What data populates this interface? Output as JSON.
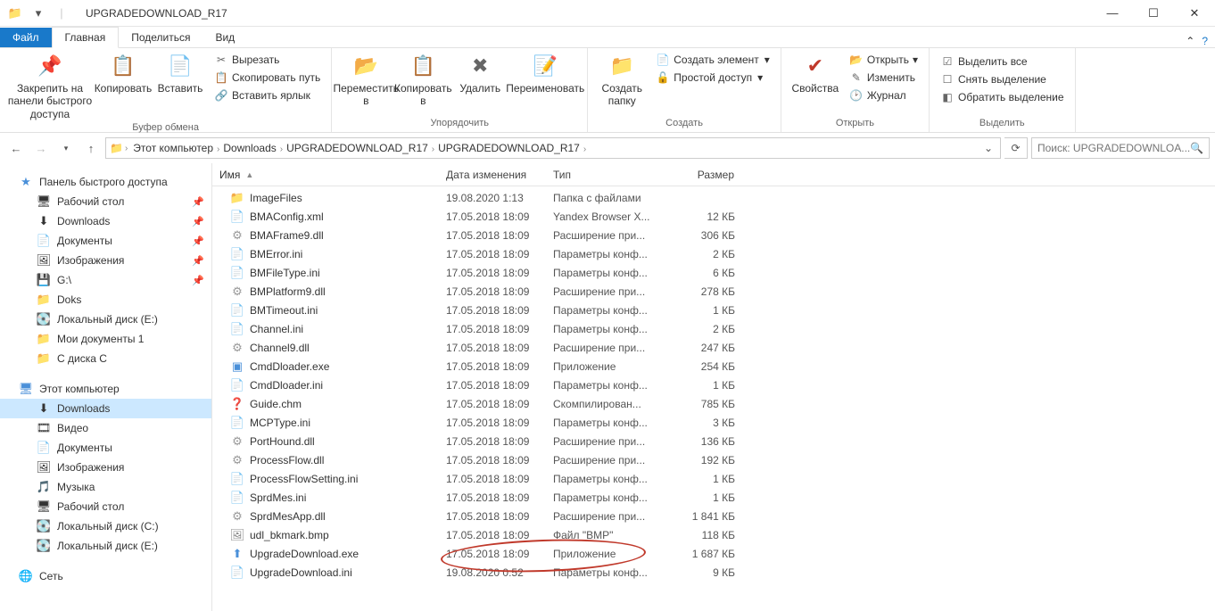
{
  "window": {
    "title": "UPGRADEDOWNLOAD_R17"
  },
  "tabs": {
    "file": "Файл",
    "home": "Главная",
    "share": "Поделиться",
    "view": "Вид"
  },
  "ribbon": {
    "clipboard": {
      "pin": "Закрепить на панели быстрого доступа",
      "copy": "Копировать",
      "paste": "Вставить",
      "cut": "Вырезать",
      "copypath": "Скопировать путь",
      "pastelnk": "Вставить ярлык",
      "label": "Буфер обмена"
    },
    "organize": {
      "move": "Переместить в",
      "copyto": "Копировать в",
      "delete": "Удалить",
      "rename": "Переименовать",
      "label": "Упорядочить"
    },
    "new": {
      "folder": "Создать папку",
      "newitem": "Создать элемент",
      "easyaccess": "Простой доступ",
      "label": "Создать"
    },
    "open": {
      "properties": "Свойства",
      "open": "Открыть",
      "edit": "Изменить",
      "history": "Журнал",
      "label": "Открыть"
    },
    "select": {
      "all": "Выделить все",
      "none": "Снять выделение",
      "invert": "Обратить выделение",
      "label": "Выделить"
    }
  },
  "breadcrumbs": [
    "Этот компьютер",
    "Downloads",
    "UPGRADEDOWNLOAD_R17",
    "UPGRADEDOWNLOAD_R17"
  ],
  "search": {
    "placeholder": "Поиск: UPGRADEDOWNLOA..."
  },
  "navpane": {
    "quickaccess": "Панель быстрого доступа",
    "items_qa": [
      {
        "label": "Рабочий стол",
        "icon": "🖥",
        "pin": true
      },
      {
        "label": "Downloads",
        "icon": "⬇",
        "pin": true
      },
      {
        "label": "Документы",
        "icon": "📄",
        "pin": true
      },
      {
        "label": "Изображения",
        "icon": "🖼",
        "pin": true
      },
      {
        "label": "G:\\",
        "icon": "💾",
        "pin": true
      },
      {
        "label": "Doks",
        "icon": "📁",
        "pin": false
      },
      {
        "label": "Локальный диск (E:)",
        "icon": "💽",
        "pin": false
      },
      {
        "label": "Мои документы 1",
        "icon": "📁",
        "pin": false
      },
      {
        "label": "С диска С",
        "icon": "📁",
        "pin": false
      }
    ],
    "thispc": "Этот компьютер",
    "items_pc": [
      {
        "label": "Downloads",
        "icon": "⬇",
        "sel": true
      },
      {
        "label": "Видео",
        "icon": "🎞",
        "sel": false
      },
      {
        "label": "Документы",
        "icon": "📄",
        "sel": false
      },
      {
        "label": "Изображения",
        "icon": "🖼",
        "sel": false
      },
      {
        "label": "Музыка",
        "icon": "🎵",
        "sel": false
      },
      {
        "label": "Рабочий стол",
        "icon": "🖥",
        "sel": false
      },
      {
        "label": "Локальный диск (C:)",
        "icon": "💽",
        "sel": false
      },
      {
        "label": "Локальный диск (E:)",
        "icon": "💽",
        "sel": false
      }
    ],
    "network": "Сеть"
  },
  "columns": {
    "name": "Имя",
    "date": "Дата изменения",
    "type": "Тип",
    "size": "Размер"
  },
  "files": [
    {
      "name": "ImageFiles",
      "date": "19.08.2020 1:13",
      "type": "Папка с файлами",
      "size": "",
      "ic": "📁",
      "cls": "folder-i"
    },
    {
      "name": "BMAConfig.xml",
      "date": "17.05.2018 18:09",
      "type": "Yandex Browser X...",
      "size": "12 КБ",
      "ic": "📄",
      "cls": "file-i"
    },
    {
      "name": "BMAFrame9.dll",
      "date": "17.05.2018 18:09",
      "type": "Расширение при...",
      "size": "306 КБ",
      "ic": "⚙",
      "cls": "dll-i"
    },
    {
      "name": "BMError.ini",
      "date": "17.05.2018 18:09",
      "type": "Параметры конф...",
      "size": "2 КБ",
      "ic": "📄",
      "cls": "ini-i"
    },
    {
      "name": "BMFileType.ini",
      "date": "17.05.2018 18:09",
      "type": "Параметры конф...",
      "size": "6 КБ",
      "ic": "📄",
      "cls": "ini-i"
    },
    {
      "name": "BMPlatform9.dll",
      "date": "17.05.2018 18:09",
      "type": "Расширение при...",
      "size": "278 КБ",
      "ic": "⚙",
      "cls": "dll-i"
    },
    {
      "name": "BMTimeout.ini",
      "date": "17.05.2018 18:09",
      "type": "Параметры конф...",
      "size": "1 КБ",
      "ic": "📄",
      "cls": "ini-i"
    },
    {
      "name": "Channel.ini",
      "date": "17.05.2018 18:09",
      "type": "Параметры конф...",
      "size": "2 КБ",
      "ic": "📄",
      "cls": "ini-i"
    },
    {
      "name": "Channel9.dll",
      "date": "17.05.2018 18:09",
      "type": "Расширение при...",
      "size": "247 КБ",
      "ic": "⚙",
      "cls": "dll-i"
    },
    {
      "name": "CmdDloader.exe",
      "date": "17.05.2018 18:09",
      "type": "Приложение",
      "size": "254 КБ",
      "ic": "▣",
      "cls": "exe-i"
    },
    {
      "name": "CmdDloader.ini",
      "date": "17.05.2018 18:09",
      "type": "Параметры конф...",
      "size": "1 КБ",
      "ic": "📄",
      "cls": "ini-i"
    },
    {
      "name": "Guide.chm",
      "date": "17.05.2018 18:09",
      "type": "Скомпилирован...",
      "size": "785 КБ",
      "ic": "❓",
      "cls": "file-i"
    },
    {
      "name": "MCPType.ini",
      "date": "17.05.2018 18:09",
      "type": "Параметры конф...",
      "size": "3 КБ",
      "ic": "📄",
      "cls": "ini-i"
    },
    {
      "name": "PortHound.dll",
      "date": "17.05.2018 18:09",
      "type": "Расширение при...",
      "size": "136 КБ",
      "ic": "⚙",
      "cls": "dll-i"
    },
    {
      "name": "ProcessFlow.dll",
      "date": "17.05.2018 18:09",
      "type": "Расширение при...",
      "size": "192 КБ",
      "ic": "⚙",
      "cls": "dll-i"
    },
    {
      "name": "ProcessFlowSetting.ini",
      "date": "17.05.2018 18:09",
      "type": "Параметры конф...",
      "size": "1 КБ",
      "ic": "📄",
      "cls": "ini-i"
    },
    {
      "name": "SprdMes.ini",
      "date": "17.05.2018 18:09",
      "type": "Параметры конф...",
      "size": "1 КБ",
      "ic": "📄",
      "cls": "ini-i"
    },
    {
      "name": "SprdMesApp.dll",
      "date": "17.05.2018 18:09",
      "type": "Расширение при...",
      "size": "1 841 КБ",
      "ic": "⚙",
      "cls": "dll-i"
    },
    {
      "name": "udl_bkmark.bmp",
      "date": "17.05.2018 18:09",
      "type": "Файл \"BMP\"",
      "size": "118 КБ",
      "ic": "🖼",
      "cls": "file-i"
    },
    {
      "name": "UpgradeDownload.exe",
      "date": "17.05.2018 18:09",
      "type": "Приложение",
      "size": "1 687 КБ",
      "ic": "⬆",
      "cls": "exe-i"
    },
    {
      "name": "UpgradeDownload.ini",
      "date": "19.08.2020 0:52",
      "type": "Параметры конф...",
      "size": "9 КБ",
      "ic": "📄",
      "cls": "ini-i"
    }
  ]
}
